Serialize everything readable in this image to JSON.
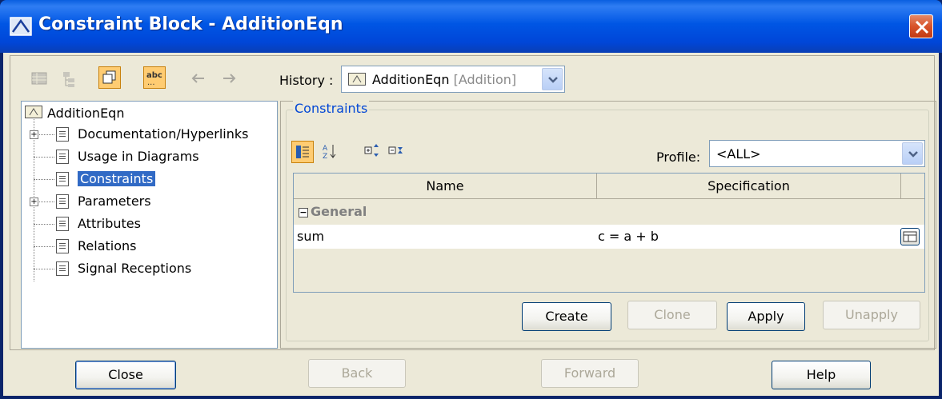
{
  "window": {
    "title": "Constraint Block - AdditionEqn"
  },
  "history": {
    "label": "History :",
    "element_name": "AdditionEqn",
    "element_type": "[Addition]"
  },
  "tree": {
    "root": "AdditionEqn",
    "items": [
      {
        "label": "Documentation/Hyperlinks",
        "expandable": true
      },
      {
        "label": "Usage in Diagrams",
        "expandable": false
      },
      {
        "label": "Constraints",
        "expandable": false,
        "selected": true
      },
      {
        "label": "Parameters",
        "expandable": true
      },
      {
        "label": "Attributes",
        "expandable": false
      },
      {
        "label": "Relations",
        "expandable": false
      },
      {
        "label": "Signal Receptions",
        "expandable": false
      }
    ]
  },
  "constraints": {
    "group_title": "Constraints",
    "profile_label": "Profile:",
    "profile_value": "<ALL>",
    "columns": [
      "Name",
      "Specification"
    ],
    "group_row": "General",
    "rows": [
      {
        "name": "sum",
        "specification": "c = a + b"
      }
    ],
    "buttons": {
      "create": "Create",
      "clone": "Clone",
      "apply": "Apply",
      "unapply": "Unapply"
    }
  },
  "footer": {
    "close": "Close",
    "back": "Back",
    "forward": "Forward",
    "help": "Help"
  },
  "colors": {
    "title_bar": "#0054e3",
    "selection": "#316ac5",
    "group_title": "#0046d5",
    "close_button": "#d8532a"
  }
}
